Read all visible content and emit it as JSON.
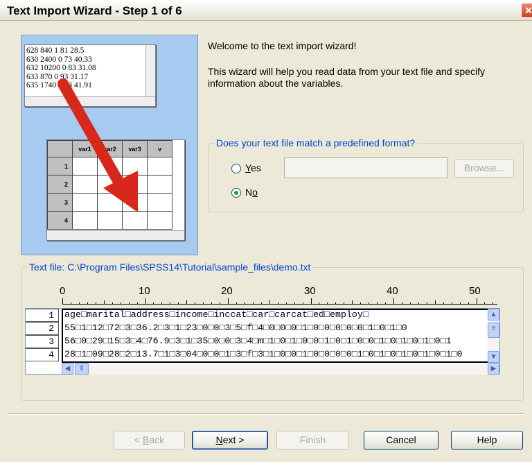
{
  "window": {
    "title": "Text Import Wizard - Step 1 of 6",
    "close_glyph": "✕"
  },
  "illustration": {
    "text_lines": [
      "628 840 1 81 28.5",
      "630 2400 0 73 40.33",
      "632 10200 0 83 31.08",
      "633 870 0 93 31.17",
      "635 1740 0 83 41.91"
    ],
    "grid_headers": [
      "var1",
      "var2",
      "var3",
      "v"
    ],
    "grid_rows": [
      "1",
      "2",
      "3",
      "4"
    ],
    "arrow_color": "#D8281C"
  },
  "welcome_text": "Welcome to the text import wizard!",
  "description_text": "This wizard will help you read data from your text file and specify information about the variables.",
  "format_group": {
    "legend": "Does your text file match a predefined format?",
    "yes_label_prefix": "",
    "yes_label_accel": "Y",
    "yes_label_rest": "es",
    "no_label_prefix": "N",
    "no_label_accel": "o",
    "selected": "No",
    "browse_label": "Browse..."
  },
  "file_group": {
    "legend": "Text file:  C:\\Program Files\\SPSS14\\Tutorial\\sample_files\\demo.txt"
  },
  "ruler": {
    "labels": [
      "0",
      "10",
      "20",
      "30",
      "40",
      "50"
    ]
  },
  "preview": {
    "rows": [
      {
        "num": "1",
        "text": "age□marital□address□income□inccat□car□carcat□ed□employ□"
      },
      {
        "num": "2",
        "text": "55□1□12□72□3□36.2□3□1□23□0□0□3□5□f□4□0□0□0□1□0□0□0□0□0□1□0□1□0"
      },
      {
        "num": "3",
        "text": "56□0□29□15□3□4□76.9□3□1□35□0□0□3□4□m□1□0□1□0□0□1□0□1□0□0□1□0□1□0□1□0□1"
      },
      {
        "num": "4",
        "text": "28□1□09□28□2□13.7□1□3□04□0□0□1□3□f□3□1□0□0□1□0□0□0□0□1□0□1□0□1□0□1□0□1□0"
      }
    ]
  },
  "buttons": {
    "back_prefix": "< ",
    "back_accel": "B",
    "back_rest": "ack",
    "next_accel": "N",
    "next_rest": "ext >",
    "finish": "Finish",
    "cancel": "Cancel",
    "help": "Help"
  },
  "colors": {
    "dialog_bg": "#ECE9D8",
    "legend_text": "#0046D5",
    "illustration_bg": "#A6CAF0"
  }
}
